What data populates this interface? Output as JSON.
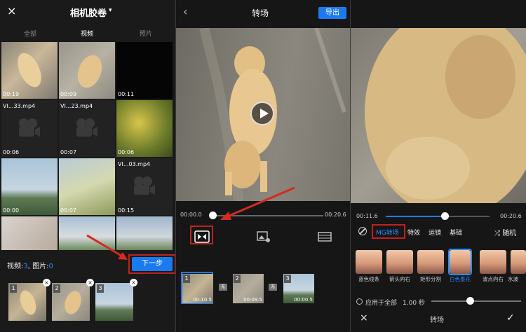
{
  "gallery": {
    "close_icon": "×",
    "album_title": "相机胶卷",
    "caret": "▾",
    "tabs": [
      "全部",
      "视频",
      "照片"
    ],
    "active_tab": "视频",
    "cells": [
      {
        "duration": "00:19",
        "filename": ""
      },
      {
        "duration": "00:09",
        "filename": ""
      },
      {
        "duration": "00:11",
        "filename": ""
      },
      {
        "duration": "00:06",
        "filename": "VI...33.mp4"
      },
      {
        "duration": "00:07",
        "filename": "VI...23.mp4"
      },
      {
        "duration": "00:06",
        "filename": ""
      },
      {
        "duration": "00:00",
        "filename": ""
      },
      {
        "duration": "00:07",
        "filename": ""
      },
      {
        "duration": "00:15",
        "filename": "VI...03.mp4"
      },
      {
        "duration": "",
        "filename": ""
      },
      {
        "duration": "",
        "filename": ""
      },
      {
        "duration": "",
        "filename": ""
      }
    ],
    "selection_label_video": "视频:",
    "video_count": "3",
    "selection_sep": ", 图片:",
    "image_count": "0",
    "next_button": "下一步",
    "selected": [
      {
        "index": "1"
      },
      {
        "index": "2"
      },
      {
        "index": "3"
      }
    ],
    "remove_icon": "×"
  },
  "editor": {
    "back_icon": "‹",
    "title": "转场",
    "export_button": "导出",
    "time_current": "00:00.0",
    "time_total": "00:20.6",
    "progress": 0.0,
    "clips": [
      {
        "index": "1",
        "duration": "00:10.5"
      },
      {
        "index": "2",
        "duration": "00:09.5"
      },
      {
        "index": "3",
        "duration": "00:00.5"
      }
    ],
    "transition_marker": "无"
  },
  "transition_panel": {
    "time_current": "00:11.6",
    "time_total": "00:20.6",
    "progress": 0.56,
    "categories": [
      "MG转场",
      "特效",
      "运镜",
      "基础"
    ],
    "active_category": "MG转场",
    "random_label": "随机",
    "effects": [
      "蓝色线条",
      "箭头向右",
      "矩形分割",
      "白色墨花",
      "波点向右",
      "水波"
    ],
    "selected_effect": "白色墨花",
    "apply_all_label": "应用于全部",
    "duration_value": "1.00 秒",
    "duration_fraction": 0.39,
    "bottom_title": "转场",
    "cancel_icon": "×",
    "confirm_icon": "✓"
  },
  "colors": {
    "accent": "#1a7bf0",
    "highlight_red": "#c0221b"
  }
}
